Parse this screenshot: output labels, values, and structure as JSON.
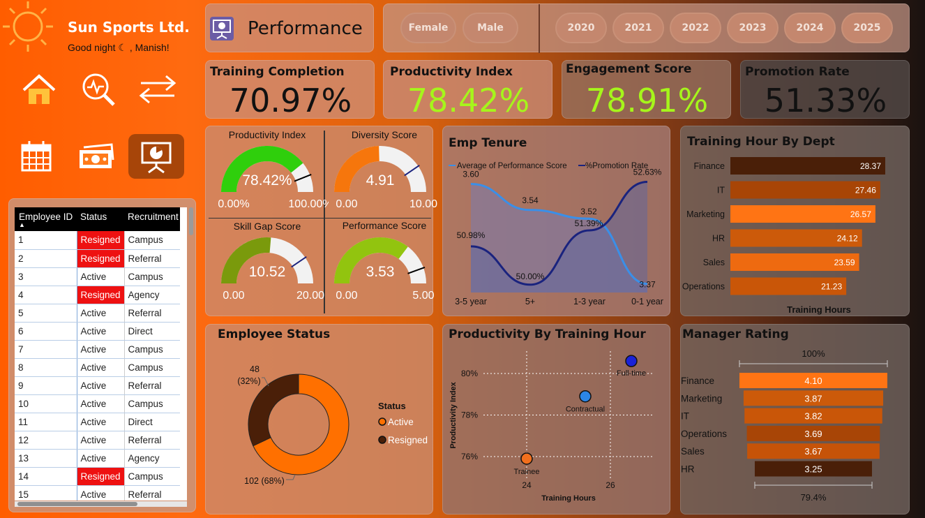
{
  "brand": {
    "name": "Sun Sports Ltd.",
    "greeting": "Good night ☾ , Manish!"
  },
  "nav": {
    "items": [
      {
        "icon": "home-icon"
      },
      {
        "icon": "search-analytics-icon"
      },
      {
        "icon": "swap-arrows-icon"
      },
      {
        "icon": "calendar-icon"
      },
      {
        "icon": "money-icon"
      },
      {
        "icon": "presentation-icon",
        "active": true
      }
    ]
  },
  "page": {
    "title": "Performance",
    "icon": "presentation-icon"
  },
  "filters": {
    "gender": [
      "Female",
      "Male"
    ],
    "years": [
      "2020",
      "2021",
      "2022",
      "2023",
      "2024",
      "2025"
    ]
  },
  "kpis": [
    {
      "label": "Training Completion",
      "value": "70.97%",
      "color": "#111111"
    },
    {
      "label": "Productivity Index",
      "value": "78.42%",
      "color": "#a6f51b"
    },
    {
      "label": "Engagement Score",
      "value": "78.91%",
      "color": "#a6f51b"
    },
    {
      "label": "Promotion Rate",
      "value": "51.33%",
      "color": "#111111"
    }
  ],
  "gauges": [
    {
      "title": "Productivity Index",
      "value": "78.42%",
      "min": "0.00%",
      "max": "100.00%",
      "fraction": 0.7842,
      "color": "#2fcf0c"
    },
    {
      "title": "Diversity Score",
      "value": "4.91",
      "min": "0.00",
      "max": "10.00",
      "fraction": 0.491,
      "color": "#f6760c"
    },
    {
      "title": "Skill Gap Score",
      "value": "10.52",
      "min": "0.00",
      "max": "20.00",
      "fraction": 0.526,
      "color": "#7a9a0c"
    },
    {
      "title": "Performance Score",
      "value": "3.53",
      "min": "0.00",
      "max": "5.00",
      "fraction": 0.706,
      "color": "#92c40f"
    }
  ],
  "table": {
    "headers": [
      "Employee ID",
      "Status",
      "Recruitment"
    ],
    "rows": [
      [
        "1",
        "Resigned",
        "Campus"
      ],
      [
        "2",
        "Resigned",
        "Referral"
      ],
      [
        "3",
        "Active",
        "Campus"
      ],
      [
        "4",
        "Resigned",
        "Agency"
      ],
      [
        "5",
        "Active",
        "Referral"
      ],
      [
        "6",
        "Active",
        "Direct"
      ],
      [
        "7",
        "Active",
        "Campus"
      ],
      [
        "8",
        "Active",
        "Campus"
      ],
      [
        "9",
        "Active",
        "Referral"
      ],
      [
        "10",
        "Active",
        "Campus"
      ],
      [
        "11",
        "Active",
        "Direct"
      ],
      [
        "12",
        "Active",
        "Referral"
      ],
      [
        "13",
        "Active",
        "Agency"
      ],
      [
        "14",
        "Resigned",
        "Campus"
      ],
      [
        "15",
        "Active",
        "Referral"
      ]
    ]
  },
  "chart_data": [
    {
      "type": "line",
      "title": "Emp Tenure",
      "categories": [
        "3-5 year",
        "5+",
        "1-3 year",
        "0-1 year"
      ],
      "series": [
        {
          "name": "Average of Performance Score",
          "values": [
            3.6,
            3.54,
            3.52,
            3.37
          ],
          "labels": [
            "3.60",
            "3.54",
            "3.52",
            "3.37"
          ],
          "color": "#3a8fe8"
        },
        {
          "name": "%Promotion Rate",
          "values": [
            50.98,
            50.0,
            51.39,
            52.63
          ],
          "labels": [
            "50.98%",
            "50.00%",
            "51.39%",
            "52.63%"
          ],
          "color": "#1a237e"
        }
      ]
    },
    {
      "type": "bar",
      "title": "Training Hour By Dept",
      "xlabel": "Training Hours",
      "categories": [
        "Finance",
        "IT",
        "Marketing",
        "HR",
        "Sales",
        "Operations"
      ],
      "values": [
        28.37,
        27.46,
        26.57,
        24.12,
        23.59,
        21.23
      ],
      "labels": [
        "28.37",
        "27.46",
        "26.57",
        "24.12",
        "23.59",
        "21.23"
      ],
      "colors": [
        "#4a1f08",
        "#a84506",
        "#ff7414",
        "#cc5a0a",
        "#ee6a10",
        "#c95608"
      ]
    },
    {
      "type": "pie",
      "title": "Employee Status",
      "legend_title": "Status",
      "slices": [
        {
          "name": "Active",
          "value": 102,
          "label": "102 (68%)",
          "color": "#ff7000"
        },
        {
          "name": "Resigned",
          "value": 48,
          "label": "48",
          "pct": "(32%)",
          "color": "#4a1f08"
        }
      ]
    },
    {
      "type": "scatter",
      "title": "Productivity By Training Hour",
      "xlabel": "Training Hours",
      "ylabel": "Productivity Index",
      "xticks": [
        "24",
        "26"
      ],
      "yticks": [
        "80%",
        "78%",
        "76%"
      ],
      "xlim": [
        22.5,
        27.5
      ],
      "ylim": [
        75.6,
        81.0
      ],
      "points": [
        {
          "name": "Full-time",
          "x": 26.5,
          "y": 80.6,
          "color": "#1a22d8"
        },
        {
          "name": "Contractual",
          "x": 25.4,
          "y": 78.9,
          "color": "#2c86e6"
        },
        {
          "name": "Trainee",
          "x": 24.0,
          "y": 75.9,
          "color": "#f26f1d"
        }
      ]
    },
    {
      "type": "funnel",
      "title": "Manager Rating",
      "top_label": "100%",
      "bottom_label": "79.4%",
      "categories": [
        "Finance",
        "Marketing",
        "IT",
        "Operations",
        "Sales",
        "HR"
      ],
      "values": [
        4.1,
        3.87,
        3.82,
        3.69,
        3.67,
        3.25
      ],
      "labels": [
        "4.10",
        "3.87",
        "3.82",
        "3.69",
        "3.67",
        "3.25"
      ],
      "colors": [
        "#ff7414",
        "#cc5a0a",
        "#c95608",
        "#a84506",
        "#c65308",
        "#4a1f08"
      ]
    }
  ]
}
